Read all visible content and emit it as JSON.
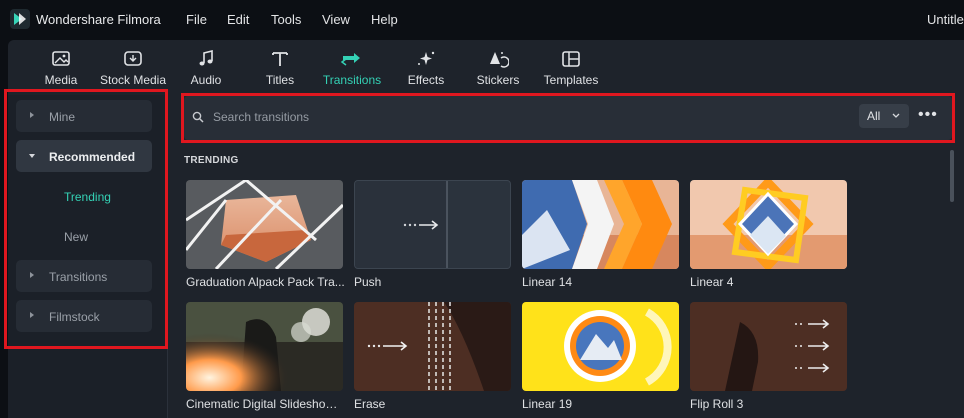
{
  "app": {
    "name": "Wondershare Filmora",
    "window_title": "Untitled"
  },
  "menu": [
    "File",
    "Edit",
    "Tools",
    "View",
    "Help"
  ],
  "toolbar": [
    {
      "label": "Media",
      "icon": "media-icon"
    },
    {
      "label": "Stock Media",
      "icon": "stock-media-icon"
    },
    {
      "label": "Audio",
      "icon": "music-note-icon"
    },
    {
      "label": "Titles",
      "icon": "text-icon"
    },
    {
      "label": "Transitions",
      "icon": "transitions-icon",
      "active": true
    },
    {
      "label": "Effects",
      "icon": "effects-sparkle-icon"
    },
    {
      "label": "Stickers",
      "icon": "stickers-icon"
    },
    {
      "label": "Templates",
      "icon": "templates-icon"
    }
  ],
  "sidebar": {
    "items": [
      {
        "label": "Mine"
      },
      {
        "label": "Recommended",
        "expanded": true
      },
      {
        "label": "Transitions"
      },
      {
        "label": "Filmstock"
      }
    ],
    "sub_items": [
      {
        "label": "Trending",
        "selected": true
      },
      {
        "label": "New"
      }
    ]
  },
  "search": {
    "placeholder": "Search transitions",
    "filter_value": "All",
    "more": "•••"
  },
  "section_title": "TRENDING",
  "transitions": [
    {
      "label": "Graduation Alpack Pack Tra..."
    },
    {
      "label": "Push"
    },
    {
      "label": "Linear 14"
    },
    {
      "label": "Linear 4"
    },
    {
      "label": "Cinematic Digital Slideshow ..."
    },
    {
      "label": "Erase"
    },
    {
      "label": "Linear 19"
    },
    {
      "label": "Flip Roll 3"
    }
  ],
  "colors": {
    "accent": "#34d1b5",
    "highlight_border": "#e0171f",
    "panel": "#1e232b",
    "background": "#0c0f14"
  }
}
